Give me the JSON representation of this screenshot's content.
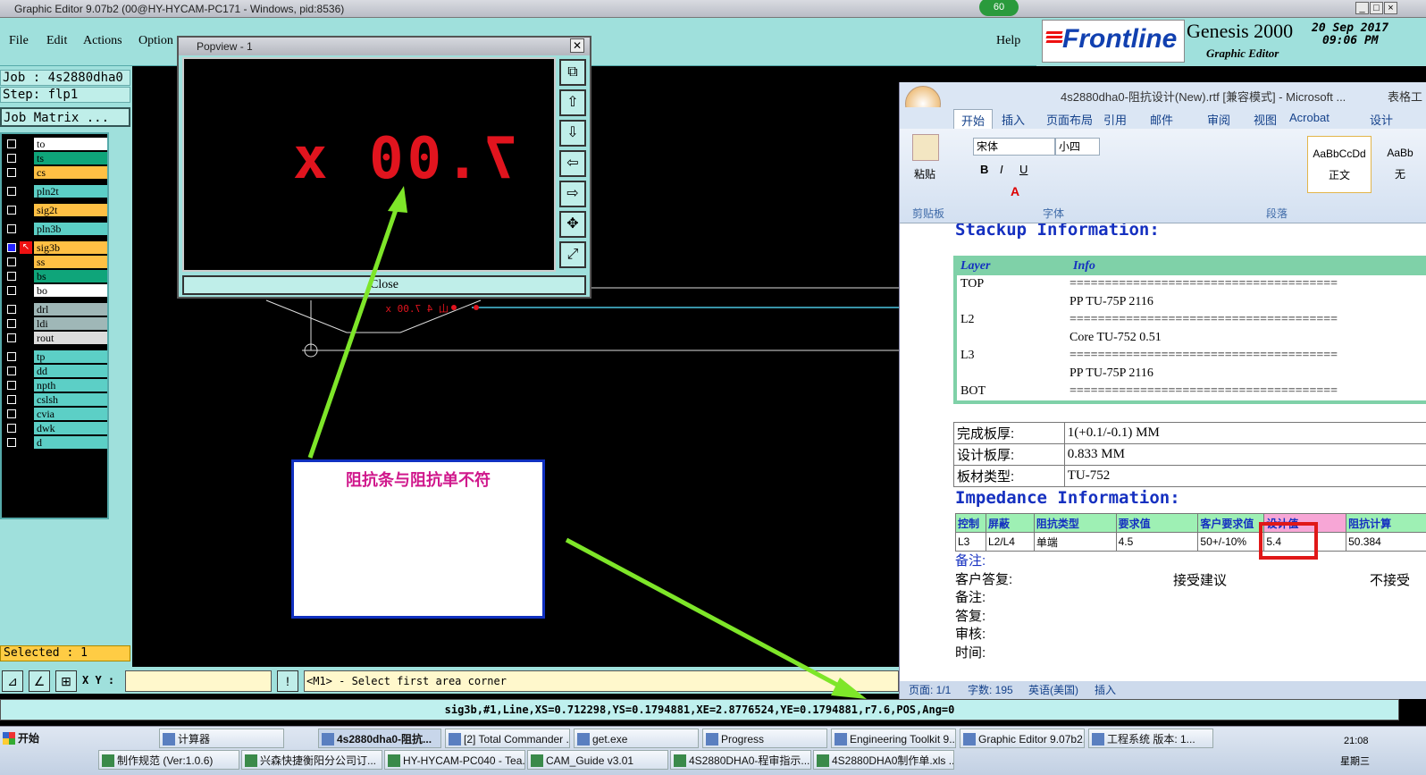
{
  "window": {
    "title": "Graphic Editor 9.07b2 (00@HY-HYCAM-PC171 - Windows, pid:8536)",
    "badge": "60"
  },
  "menu": {
    "items": [
      "File",
      "Edit",
      "Actions",
      "Option"
    ],
    "help": "Help"
  },
  "branding": {
    "logo": "Frontline",
    "product": "Genesis 2000",
    "subtitle": "Graphic Editor",
    "date": "20 Sep 2017",
    "time": "09:06 PM"
  },
  "job": {
    "job_label": "Job : 4s2880dha0",
    "step_label": "Step: flp1",
    "matrix_button": "Job Matrix ..."
  },
  "layers": [
    {
      "name": "to",
      "color": "#ffffff"
    },
    {
      "name": "ts",
      "color": "#0fa57a"
    },
    {
      "name": "cs",
      "color": "#ffc044"
    },
    {
      "name": "pln2t",
      "color": "#5ccfc6"
    },
    {
      "name": "sig2t",
      "color": "#ffc044"
    },
    {
      "name": "pln3b",
      "color": "#5ccfc6"
    },
    {
      "name": "sig3b",
      "color": "#ffc044"
    },
    {
      "name": "ss",
      "color": "#ffc044"
    },
    {
      "name": "bs",
      "color": "#0fa57a"
    },
    {
      "name": "bo",
      "color": "#ffffff"
    },
    {
      "name": "drl",
      "color": "#9fb7b7"
    },
    {
      "name": "ldi",
      "color": "#9fb7b7"
    },
    {
      "name": "rout",
      "color": "#dcdcdc"
    },
    {
      "name": "tp",
      "color": "#5ccfc6"
    },
    {
      "name": "dd",
      "color": "#5ccfc6"
    },
    {
      "name": "npth",
      "color": "#5ccfc6"
    },
    {
      "name": "cslsh",
      "color": "#5ccfc6"
    },
    {
      "name": "cvia",
      "color": "#5ccfc6"
    },
    {
      "name": "dwk",
      "color": "#5ccfc6"
    },
    {
      "name": "d",
      "color": "#5ccfc6"
    }
  ],
  "selected": "Selected : 1",
  "bottom": {
    "xy_label": "X Y :",
    "prompt": "<M1> - Select first area corner",
    "status": "sig3b,#1,Line,XS=0.712298,YS=0.1794881,XE=2.8776524,YE=0.1794881,r7.6,POS,Ang=0"
  },
  "popview": {
    "title": "Popview - 1",
    "text": "山 4 7.00 x",
    "close": "Close",
    "canvas_text": "山 4 7.00 x"
  },
  "annotation": "阻抗条与阻抗单不符",
  "word": {
    "title": "4s2880dha0-阻抗设计(New).rtf [兼容模式] - Microsoft ...",
    "title_right": "表格工具",
    "tabs": [
      "开始",
      "插入",
      "页面布局",
      "引用",
      "邮件",
      "审阅",
      "视图",
      "Acrobat",
      "设计"
    ],
    "ribbon": {
      "paste": "粘贴",
      "clipboard": "剪贴板",
      "font_name": "宋体",
      "font_size": "小四",
      "font_group": "字体",
      "para_group": "段落",
      "style1": "AaBbCcDd",
      "style1_name": "正文",
      "style2": "AaBb",
      "style2_name": "无"
    },
    "stackup_heading": "Stackup Information:",
    "stackup_header": [
      "Layer",
      "Info"
    ],
    "stackup_rows": [
      [
        "TOP",
        "======================================"
      ],
      [
        "",
        "PP    TU-75P    2116"
      ],
      [
        "L2",
        "======================================"
      ],
      [
        "",
        "Core     TU-752     0.51"
      ],
      [
        "L3",
        "======================================"
      ],
      [
        "",
        "PP    TU-75P    2116"
      ],
      [
        "BOT",
        "======================================"
      ]
    ],
    "info_rows": [
      [
        "完成板厚:",
        "1(+0.1/-0.1) MM"
      ],
      [
        "设计板厚:",
        "0.833 MM"
      ],
      [
        "板材类型:",
        "TU-752"
      ]
    ],
    "impedance_heading": "Impedance Information:",
    "imp_header": [
      "控制",
      "屏蔽",
      "阻抗类型",
      "要求值",
      "客户要求值",
      "设计值",
      "阻抗计算"
    ],
    "imp_row": [
      "L3",
      "L2/L4",
      "单端",
      "4.5",
      "50+/-10%",
      "5.4",
      "50.384"
    ],
    "notes": [
      "备注:",
      "客户答复:",
      "备注:",
      "答复:",
      "审核:",
      "时间:"
    ],
    "accept": "接受建议",
    "reject": "不接受",
    "status": {
      "page": "页面: 1/1",
      "words": "字数: 195",
      "lang": "英语(美国)",
      "mode": "插入"
    }
  },
  "taskbar": {
    "start": "开始",
    "row1": [
      "计算器",
      "4s2880dha0-阻抗...",
      "[2] Total Commander ...",
      "get.exe",
      "Progress",
      "Engineering Toolkit 9....",
      "Graphic Editor 9.07b2...",
      "工程系统  版本: 1..."
    ],
    "row2": [
      "制作规范 (Ver:1.0.6)",
      "兴森快捷衡阳分公司订...",
      "HY-HYCAM-PC040 - Tea...",
      "CAM_Guide v3.01",
      "4S2880DHA0-程审指示...",
      "4S2880DHA0制作单.xls ..."
    ],
    "clock": "21:08",
    "day": "星期三"
  }
}
